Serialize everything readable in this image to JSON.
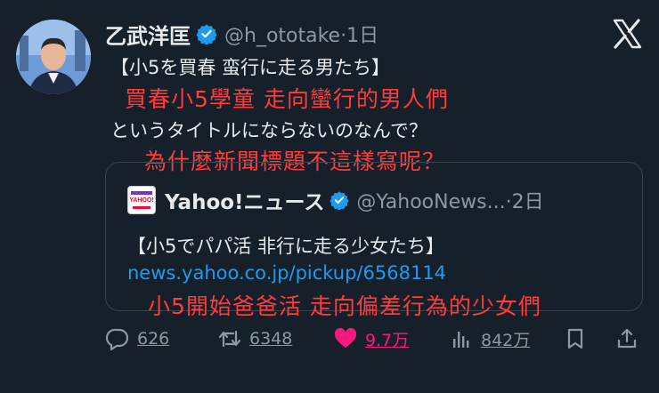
{
  "author": {
    "name": "乙武洋匡",
    "handle": "@h_ototake",
    "time": "1日"
  },
  "tweet": {
    "line1": "【小5を買春 蛮行に走る男たち】",
    "line2": "というタイトルにならないのなんで？"
  },
  "overlays": {
    "translation1": "買春小5學童 走向蠻行的男人們",
    "translation2": "為什麼新聞標題不這樣寫呢？",
    "translation3": "小5開始爸爸活 走向偏差行為的少女們"
  },
  "quote": {
    "name": "Yahoo!ニュース",
    "handle": "@YahooNews...",
    "time": "2日",
    "logo_text": "YAHOO!",
    "text": "【小5でパパ活 非行に走る少女たち】",
    "link": "news.yahoo.co.jp/pickup/6568114"
  },
  "actions": {
    "replies": "626",
    "reposts": "6348",
    "likes": "9.7万",
    "views": "842万"
  },
  "colors": {
    "background": "#15202b",
    "accent": "#1d9bf0",
    "overlay_text": "#ff3b3b",
    "like": "#f91880",
    "muted": "#8b98a5"
  }
}
